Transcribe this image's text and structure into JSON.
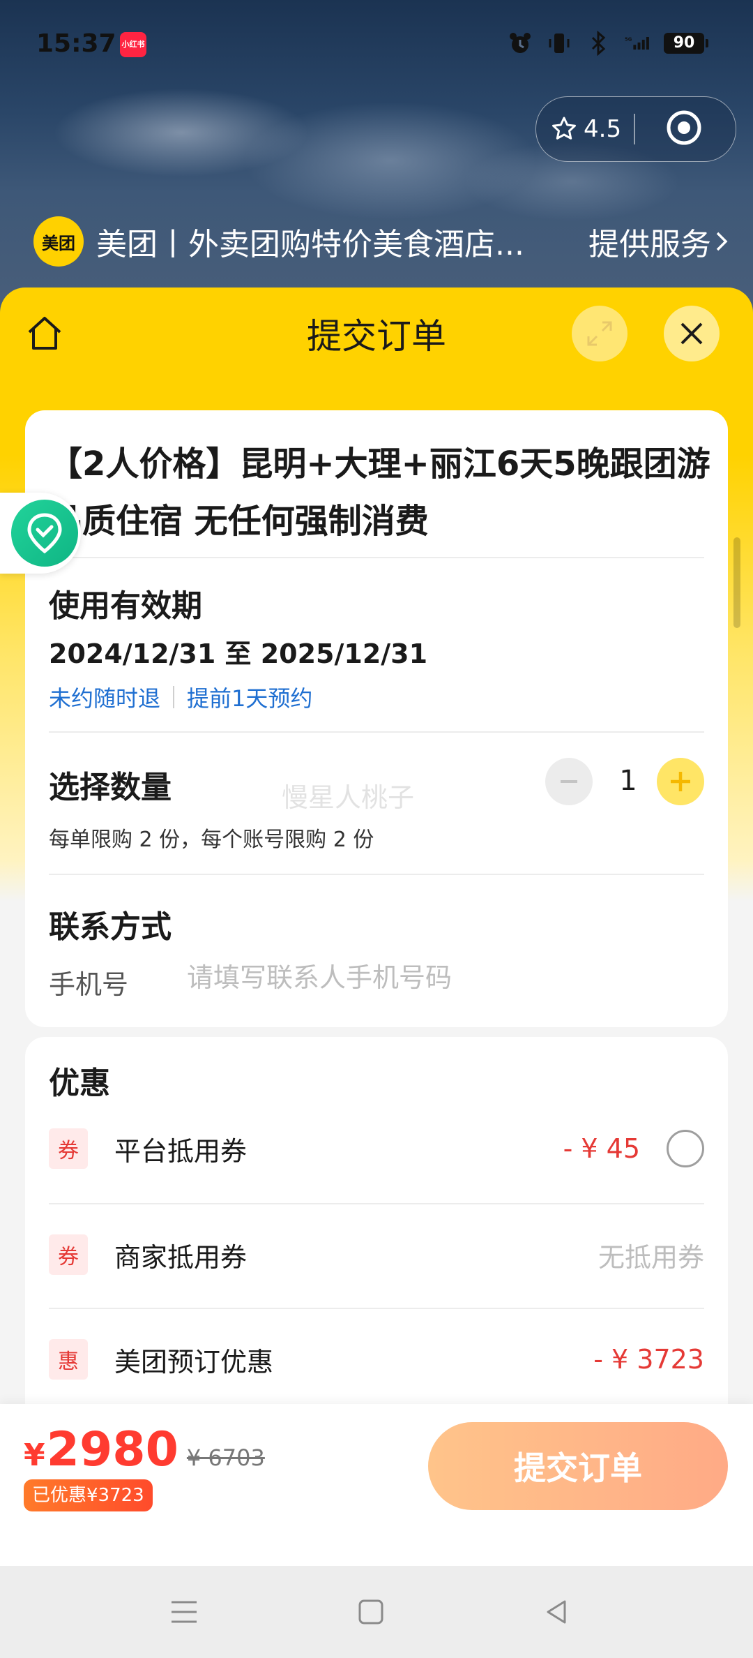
{
  "status_bar": {
    "time": "15:37",
    "app_badge": "小红书",
    "battery": "90",
    "network": "5G"
  },
  "capsule": {
    "rating": "4.5",
    "icons": [
      "star-icon",
      "target-icon"
    ]
  },
  "service_bar": {
    "logo_text": "美团",
    "title": "美团丨外卖团购特价美食酒店...",
    "link_label": "提供服务"
  },
  "sheet": {
    "title": "提交订单"
  },
  "product": {
    "title": "【2人价格】昆明+大理+丽江6天5晚跟团游品质住宿 无任何强制消费",
    "validity_heading": "使用有效期",
    "dates": "2024/12/31 至 2025/12/31",
    "policy_refund": "未约随时退",
    "policy_reserve": "提前1天预约",
    "quantity_heading": "选择数量",
    "quantity": "1",
    "limit_text": "每单限购 2 份，每个账号限购 2 份",
    "watermark": "慢星人桃子",
    "contact_heading": "联系方式",
    "phone_label": "手机号",
    "phone_placeholder": "请填写联系人手机号码"
  },
  "discounts": {
    "heading": "优惠",
    "items": [
      {
        "tag": "券",
        "label": "平台抵用券",
        "value": "- ¥ 45"
      },
      {
        "tag": "券",
        "label": "商家抵用券",
        "value": "无抵用券"
      },
      {
        "tag": "惠",
        "label": "美团预订优惠",
        "value": "- ¥ 3723"
      }
    ]
  },
  "footer": {
    "currency": "¥",
    "price": "2980",
    "original_price": "¥ 6703",
    "saved_badge": "已优惠¥3723",
    "submit_label": "提交订单"
  },
  "colors": {
    "brand_yellow": "#ffd200",
    "price_red": "#ff3b30",
    "link_blue": "#1f6fd1",
    "submit_gradient_start": "#ffc48a",
    "submit_gradient_end": "#ffaa86"
  }
}
